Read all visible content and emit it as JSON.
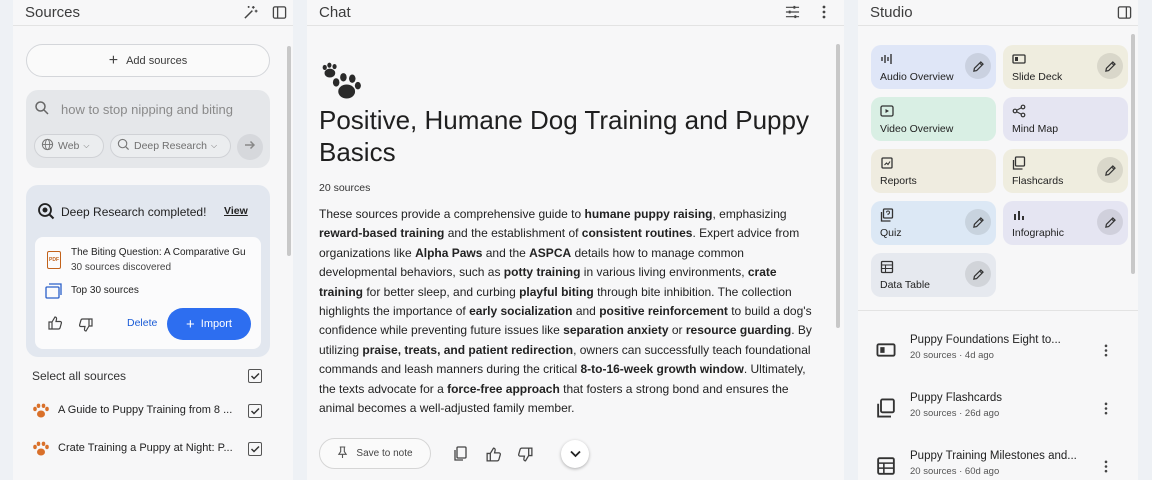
{
  "sources": {
    "title": "Sources",
    "add_sources": "Add sources",
    "search_placeholder": "how to stop nipping and biting",
    "web_chip": "Web",
    "deep_research_chip": "Deep Research",
    "deep_research": {
      "status": "Deep Research completed!",
      "view": "View",
      "report_name": "The Biting Question: A Comparative Gu",
      "report_sub": "30 sources discovered",
      "top_sources": "Top 30 sources",
      "delete": "Delete",
      "import": "Import"
    },
    "select_all": "Select all sources",
    "items": [
      {
        "label": "A Guide to Puppy Training from 8 ..."
      },
      {
        "label": "Crate Training a Puppy at Night: P..."
      }
    ]
  },
  "chat": {
    "title": "Chat",
    "heading": "Positive, Humane Dog Training and Puppy Basics",
    "source_count": "20 sources",
    "summary": [
      {
        "t": "These sources provide a comprehensive guide to "
      },
      {
        "t": "humane puppy raising",
        "b": true
      },
      {
        "t": ", emphasizing "
      },
      {
        "t": "reward-based training",
        "b": true
      },
      {
        "t": " and the establishment of "
      },
      {
        "t": "consistent routines",
        "b": true
      },
      {
        "t": ". Expert advice from organizations like "
      },
      {
        "t": "Alpha Paws",
        "b": true
      },
      {
        "t": " and the "
      },
      {
        "t": "ASPCA",
        "b": true
      },
      {
        "t": " details how to manage common developmental behaviors, such as "
      },
      {
        "t": "potty training",
        "b": true
      },
      {
        "t": " in various living environments, "
      },
      {
        "t": "crate training",
        "b": true
      },
      {
        "t": " for better sleep, and curbing "
      },
      {
        "t": "playful biting",
        "b": true
      },
      {
        "t": " through bite inhibition. The collection highlights the importance of "
      },
      {
        "t": "early socialization",
        "b": true
      },
      {
        "t": " and "
      },
      {
        "t": "positive reinforcement",
        "b": true
      },
      {
        "t": " to build a dog's confidence while preventing future issues like "
      },
      {
        "t": "separation anxiety",
        "b": true
      },
      {
        "t": " or "
      },
      {
        "t": "resource guarding",
        "b": true
      },
      {
        "t": ". By utilizing "
      },
      {
        "t": "praise, treats, and patient redirection",
        "b": true
      },
      {
        "t": ", owners can successfully teach foundational commands and leash manners during the critical "
      },
      {
        "t": "8-to-16-week growth window",
        "b": true
      },
      {
        "t": ". Ultimately, the texts advocate for a "
      },
      {
        "t": "force-free approach",
        "b": true
      },
      {
        "t": " that fosters a strong bond and ensures the animal becomes a well-adjusted family member."
      }
    ],
    "save_to_note": "Save to note"
  },
  "studio": {
    "title": "Studio",
    "tiles": [
      {
        "label": "Audio Overview",
        "color": "#dfe6f7",
        "icon": "audio-waveform-icon",
        "editable": true
      },
      {
        "label": "Slide Deck",
        "color": "#efeddf",
        "icon": "slides-icon",
        "editable": true
      },
      {
        "label": "Video Overview",
        "color": "#d9efe4",
        "icon": "video-icon",
        "editable": false
      },
      {
        "label": "Mind Map",
        "color": "#e5e5f2",
        "icon": "mind-map-icon",
        "editable": false
      },
      {
        "label": "Reports",
        "color": "#efece0",
        "icon": "reports-icon",
        "editable": false
      },
      {
        "label": "Flashcards",
        "color": "#efeddf",
        "icon": "flashcards-icon",
        "editable": true
      },
      {
        "label": "Quiz",
        "color": "#dce8f5",
        "icon": "quiz-icon",
        "editable": true
      },
      {
        "label": "Infographic",
        "color": "#e5e5f2",
        "icon": "infographic-icon",
        "editable": true
      },
      {
        "label": "Data Table",
        "color": "#e6e9ef",
        "icon": "table-icon",
        "editable": true
      }
    ],
    "notes": [
      {
        "title": "Puppy Foundations Eight to...",
        "meta": "20 sources · 4d ago",
        "icon": "slides-icon"
      },
      {
        "title": "Puppy Flashcards",
        "meta": "20 sources · 26d ago",
        "icon": "flashcards-icon"
      },
      {
        "title": "Puppy Training Milestones and...",
        "meta": "20 sources · 60d ago",
        "icon": "table-icon"
      }
    ]
  }
}
